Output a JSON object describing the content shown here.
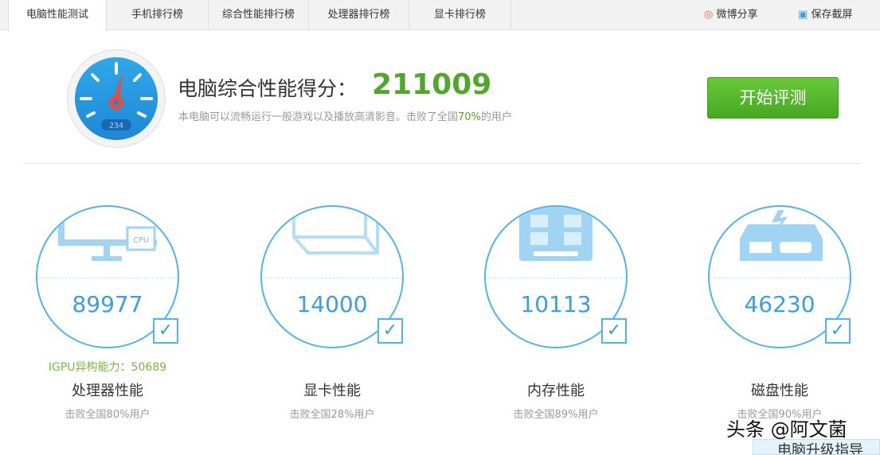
{
  "tabs": [
    "电脑性能测试",
    "手机排行榜",
    "综合性能排行榜",
    "处理器排行榜",
    "显卡排行榜"
  ],
  "actions": {
    "weibo": "微博分享",
    "screenshot": "保存截屏"
  },
  "gauge_display": "234",
  "header": {
    "title": "电脑综合性能得分：",
    "score": "211009",
    "desc_pre": "本电脑可以流畅运行一般游戏以及播放高清影音。击败了全国",
    "desc_pct": "70%",
    "desc_post": "的用户",
    "start": "开始评测"
  },
  "cards": [
    {
      "score": "89977",
      "igpu": "IGPU异构能力：50689",
      "label": "处理器性能",
      "beat": "击败全国80%用户",
      "icon_text": "CPU"
    },
    {
      "score": "14000",
      "label": "显卡性能",
      "beat": "击败全国28%用户"
    },
    {
      "score": "10113",
      "label": "内存性能",
      "beat": "击败全国89%用户"
    },
    {
      "score": "46230",
      "label": "磁盘性能",
      "beat": "击败全国90%用户"
    }
  ],
  "watermark": "头条 @阿文菌",
  "popup": "电脑升级指导",
  "colors": {
    "accent": "#3a9ee0",
    "green": "#4ea82a"
  }
}
